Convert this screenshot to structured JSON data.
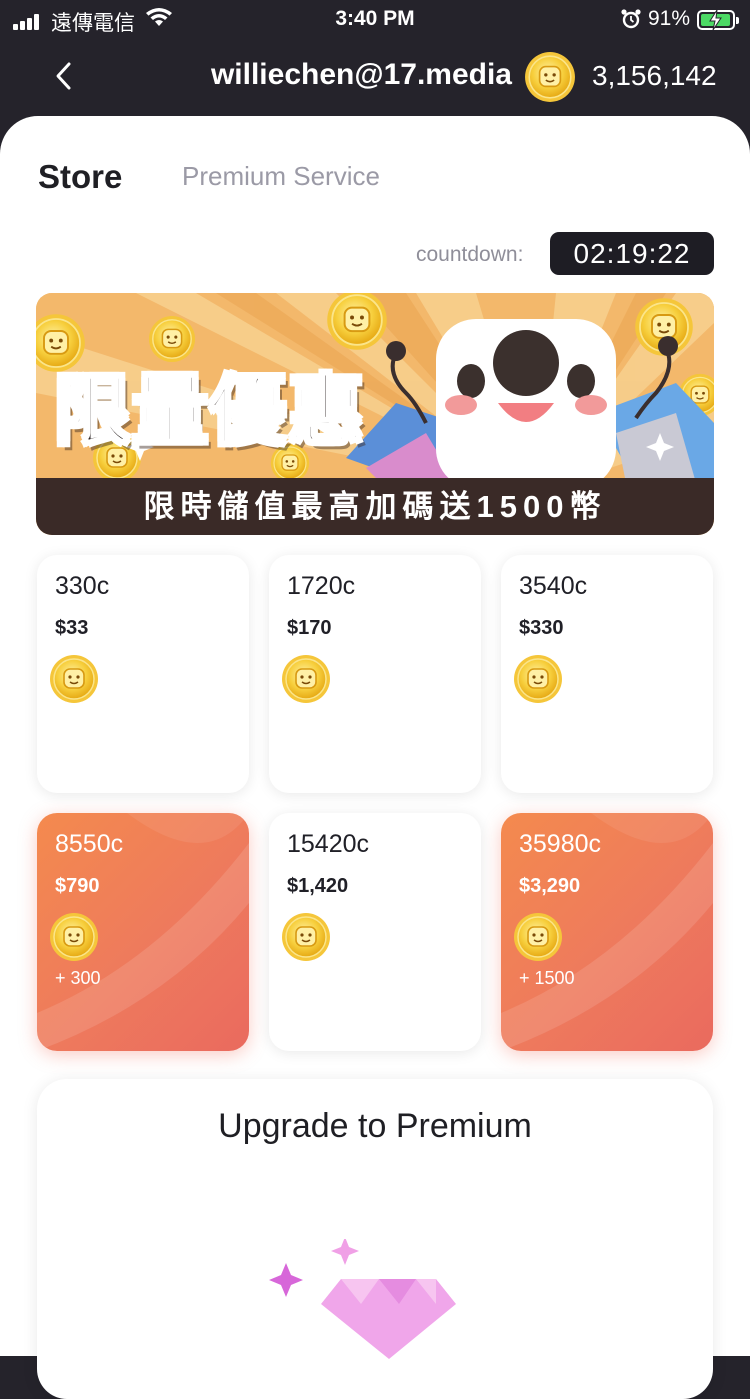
{
  "status_bar": {
    "carrier": "遠傳電信",
    "time": "3:40 PM",
    "battery_pct": "91%",
    "battery_level": 0.91,
    "icons": [
      "signal-icon",
      "wifi-icon",
      "alarm-icon",
      "battery-charging-icon"
    ]
  },
  "header": {
    "back_icon": "chevron-left-icon",
    "account": "williechen@17.media",
    "balance": "3,156,142",
    "coin_icon": "coin-icon"
  },
  "tabs": [
    {
      "label": "Store",
      "active": true
    },
    {
      "label": "Premium Service",
      "active": false
    }
  ],
  "countdown": {
    "label": "countdown:",
    "value": "02:19:22"
  },
  "banner": {
    "title": "限量優惠",
    "subtitle": "限時儲值最高加碼送1500幣"
  },
  "packages": [
    {
      "coins": "330c",
      "price": "$33",
      "bonus": "",
      "highlighted": false
    },
    {
      "coins": "1720c",
      "price": "$170",
      "bonus": "",
      "highlighted": false
    },
    {
      "coins": "3540c",
      "price": "$330",
      "bonus": "",
      "highlighted": false
    },
    {
      "coins": "8550c",
      "price": "$790",
      "bonus": "+ 300",
      "highlighted": true
    },
    {
      "coins": "15420c",
      "price": "$1,420",
      "bonus": "",
      "highlighted": false
    },
    {
      "coins": "35980c",
      "price": "$3,290",
      "bonus": "+ 1500",
      "highlighted": true
    }
  ],
  "premium": {
    "title": "Upgrade to Premium",
    "icon": "diamond-icon"
  },
  "colors": {
    "header_bg": "#25232b",
    "accent_orange": "#f07a55",
    "countdown_bg": "#1e1d24",
    "coin_gold": "#f6c43b"
  }
}
